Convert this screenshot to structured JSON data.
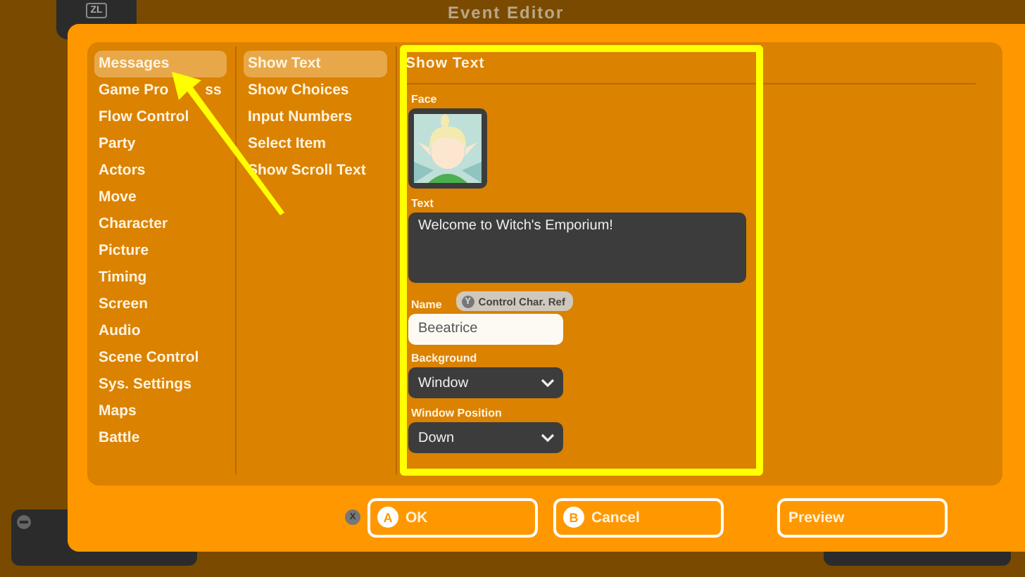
{
  "background": {
    "title": "Event Editor",
    "top_button": "ZL"
  },
  "dialog": {
    "categories": [
      {
        "label": "Messages",
        "selected": true
      },
      {
        "label": "Game Pro",
        "hidden_gap_then": "ss",
        "selected": false
      },
      {
        "label": "Flow Control",
        "selected": false
      },
      {
        "label": "Party",
        "selected": false
      },
      {
        "label": "Actors",
        "selected": false
      },
      {
        "label": "Move",
        "selected": false
      },
      {
        "label": "Character",
        "selected": false
      },
      {
        "label": "Picture",
        "selected": false
      },
      {
        "label": "Timing",
        "selected": false
      },
      {
        "label": "Screen",
        "selected": false
      },
      {
        "label": "Audio",
        "selected": false
      },
      {
        "label": "Scene Control",
        "selected": false
      },
      {
        "label": "Sys. Settings",
        "selected": false
      },
      {
        "label": "Maps",
        "selected": false
      },
      {
        "label": "Battle",
        "selected": false
      }
    ],
    "commands": [
      {
        "label": "Show Text",
        "selected": true
      },
      {
        "label": "Show Choices",
        "selected": false
      },
      {
        "label": "Input Numbers",
        "selected": false
      },
      {
        "label": "Select Item",
        "selected": false
      },
      {
        "label": "Show Scroll Text",
        "selected": false
      }
    ],
    "panel": {
      "title": "Show Text",
      "face_label": "Face",
      "text_label": "Text",
      "text_value": "Welcome to Witch's Emporium!",
      "name_label": "Name",
      "name_hint": {
        "key": "Y",
        "label": "Control Char. Ref"
      },
      "name_value": "Beeatrice",
      "fields": [
        {
          "label": "Background",
          "value": "Window"
        },
        {
          "label": "Window Position",
          "value": "Down"
        }
      ]
    },
    "x_key": "X",
    "buttons": [
      {
        "key": "A",
        "label": "OK"
      },
      {
        "key": "B",
        "label": "Cancel"
      },
      {
        "label": "Preview"
      }
    ]
  }
}
